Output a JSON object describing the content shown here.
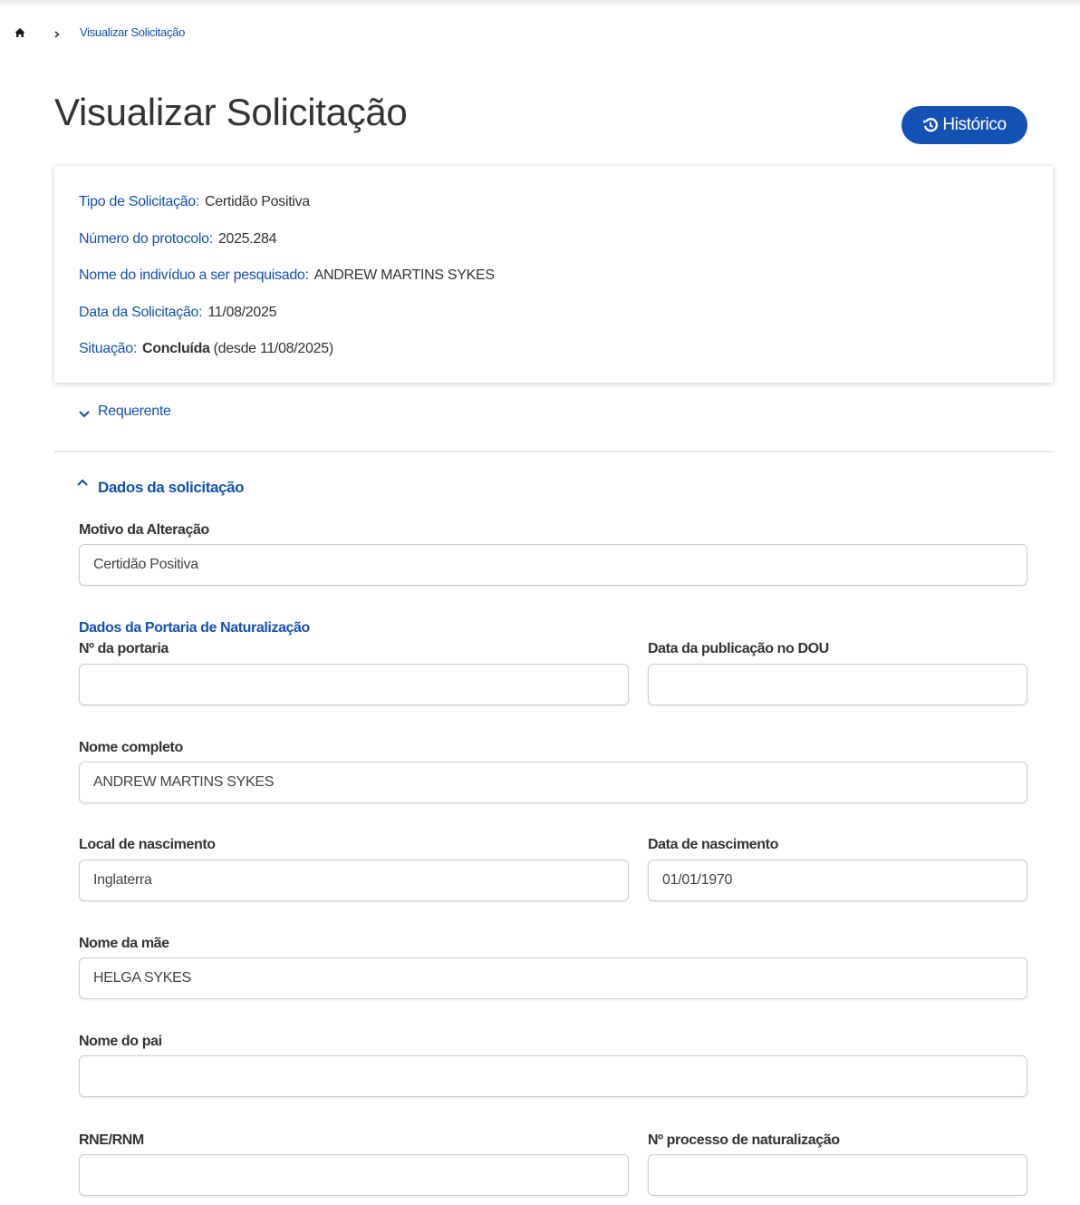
{
  "breadcrumb": {
    "home_icon": "home-icon",
    "separator_icon": "chevron-right-icon",
    "current": "Visualizar Solicitação"
  },
  "page": {
    "title": "Visualizar Solicitação",
    "history_button": "Histórico",
    "history_icon": "history-icon"
  },
  "summary": {
    "tipo_label": "Tipo de Solicitação:",
    "tipo_value": "Certidão Positiva",
    "protocolo_label": "Número do protocolo:",
    "protocolo_value": "2025.284",
    "nome_label": "Nome do indivíduo a ser pesquisado:",
    "nome_value": "ANDREW MARTINS SYKES",
    "data_label": "Data da Solicitação:",
    "data_value": "11/08/2025",
    "situacao_label": "Situação:",
    "situacao_value": "Concluída",
    "situacao_since": "(desde 11/08/2025)"
  },
  "sections": {
    "requerente": "Requerente",
    "dados": "Dados da solicitação",
    "portaria": "Dados da Portaria de Naturalização"
  },
  "fields": {
    "motivo": {
      "label": "Motivo da Alteração",
      "value": "Certidão Positiva"
    },
    "portaria": {
      "label": "Nº da portaria",
      "value": ""
    },
    "data_publicacao": {
      "label": "Data da publicação no DOU",
      "value": ""
    },
    "nome_completo": {
      "label": "Nome completo",
      "value": "ANDREW MARTINS SYKES"
    },
    "local_nascimento": {
      "label": "Local de nascimento",
      "value": "Inglaterra"
    },
    "data_nascimento": {
      "label": "Data de nascimento",
      "value": "01/01/1970"
    },
    "nome_mae": {
      "label": "Nome da mãe",
      "value": "HELGA SYKES"
    },
    "nome_pai": {
      "label": "Nome do pai",
      "value": ""
    },
    "rne": {
      "label": "RNE/RNM",
      "value": ""
    },
    "processo": {
      "label": "Nº processo de naturalização",
      "value": ""
    }
  },
  "colors": {
    "primary": "#1351b4",
    "text": "#333333",
    "border": "#cccccc"
  }
}
